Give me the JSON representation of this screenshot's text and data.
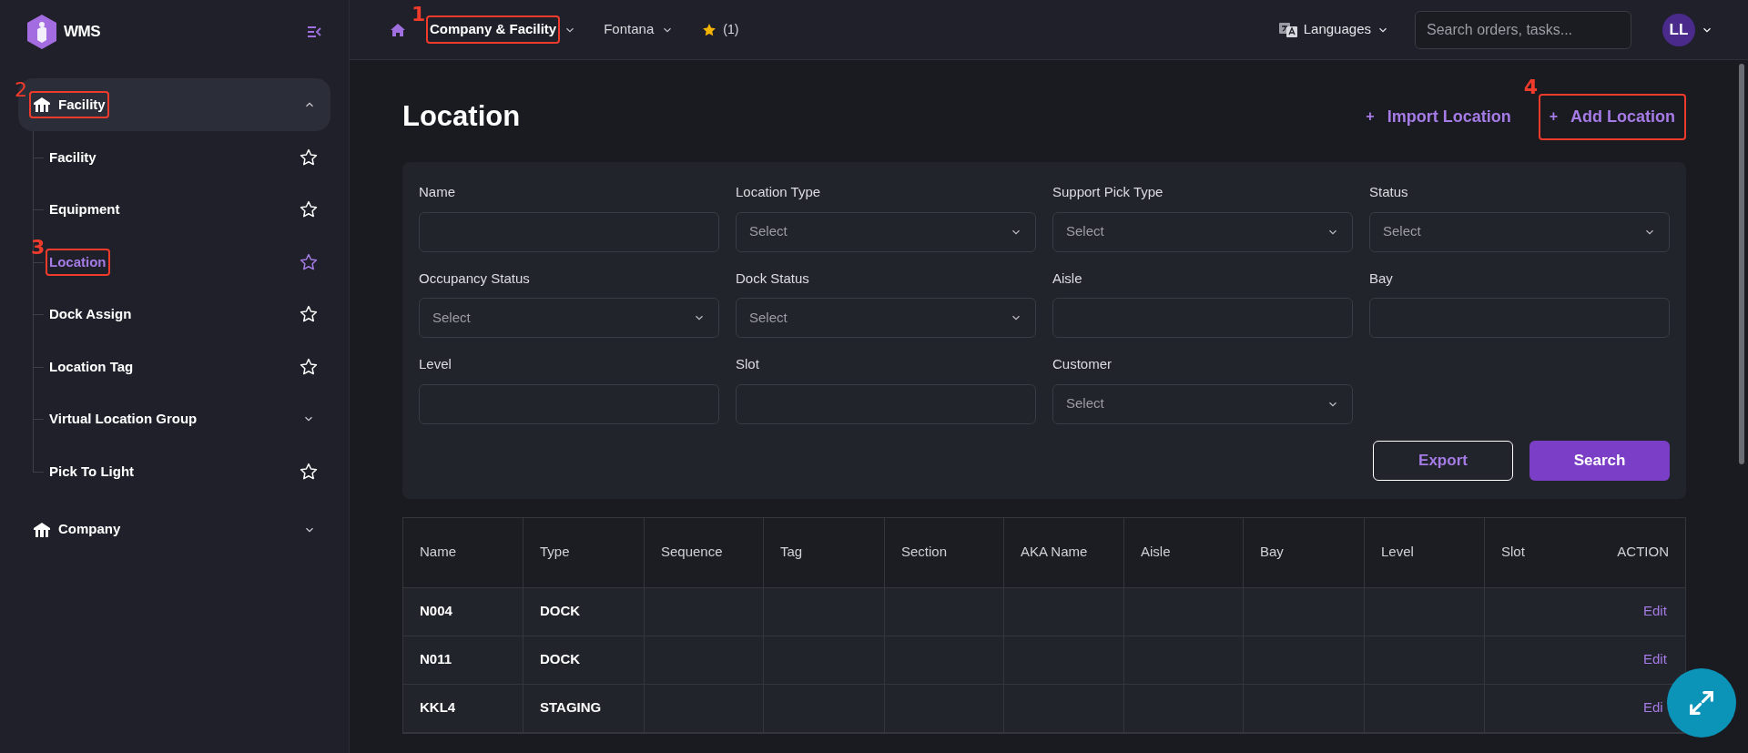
{
  "app": {
    "name": "WMS"
  },
  "sidebar": {
    "groups": [
      {
        "label": "Facility",
        "expanded": true,
        "annotation": "2",
        "items": [
          {
            "label": "Facility",
            "kind": "star",
            "selected": false
          },
          {
            "label": "Equipment",
            "kind": "star",
            "selected": false
          },
          {
            "label": "Location",
            "kind": "star",
            "selected": true,
            "annotation": "3"
          },
          {
            "label": "Dock Assign",
            "kind": "star",
            "selected": false
          },
          {
            "label": "Location Tag",
            "kind": "star",
            "selected": false
          },
          {
            "label": "Virtual Location Group",
            "kind": "submenu",
            "selected": false
          },
          {
            "label": "Pick To Light",
            "kind": "star",
            "selected": false
          }
        ]
      },
      {
        "label": "Company",
        "expanded": false
      }
    ]
  },
  "topbar": {
    "breadcrumbs": [
      {
        "label": "Company & Facility",
        "annotation": "1"
      },
      {
        "label": "Fontana"
      }
    ],
    "favorites": "(1)",
    "languages": "Languages",
    "search_placeholder": "Search orders, tasks...",
    "avatar": "LL"
  },
  "page": {
    "title": "Location",
    "actions": [
      {
        "icon": "+",
        "label": "Import Location"
      },
      {
        "icon": "+",
        "label": "Add Location",
        "annotation": "4"
      }
    ]
  },
  "filters": [
    {
      "label": "Name",
      "kind": "text"
    },
    {
      "label": "Location Type",
      "kind": "select",
      "placeholder": "Select"
    },
    {
      "label": "Support Pick Type",
      "kind": "select",
      "placeholder": "Select"
    },
    {
      "label": "Status",
      "kind": "select",
      "placeholder": "Select"
    },
    {
      "label": "Occupancy Status",
      "kind": "select",
      "placeholder": "Select"
    },
    {
      "label": "Dock Status",
      "kind": "select",
      "placeholder": "Select"
    },
    {
      "label": "Aisle",
      "kind": "text"
    },
    {
      "label": "Bay",
      "kind": "text"
    },
    {
      "label": "Level",
      "kind": "text"
    },
    {
      "label": "Slot",
      "kind": "text"
    },
    {
      "label": "Customer",
      "kind": "select",
      "placeholder": "Select"
    }
  ],
  "filter_buttons": [
    "Export",
    "Search"
  ],
  "table": {
    "columns": [
      "Name",
      "Type",
      "Sequence",
      "Tag",
      "Section",
      "AKA Name",
      "Aisle",
      "Bay",
      "Level",
      "Slot",
      "ACTION"
    ],
    "rows": [
      {
        "cells": [
          "N004",
          "DOCK",
          "",
          "",
          "",
          "",
          "",
          "",
          "",
          ""
        ],
        "action": "Edit"
      },
      {
        "cells": [
          "N011",
          "DOCK",
          "",
          "",
          "",
          "",
          "",
          "",
          "",
          ""
        ],
        "action": "Edit"
      },
      {
        "cells": [
          "KKL4",
          "STAGING",
          "",
          "",
          "",
          "",
          "",
          "",
          "",
          ""
        ],
        "action": "Edi"
      }
    ]
  }
}
